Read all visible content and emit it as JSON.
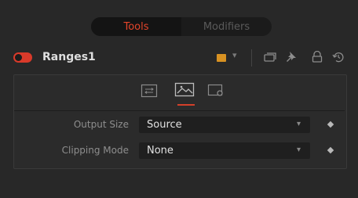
{
  "tabs": {
    "tools": "Tools",
    "modifiers": "Modifiers"
  },
  "node": {
    "name": "Ranges1",
    "color": "#d89222",
    "toggle_color": "#d93a2a"
  },
  "controls": [
    {
      "label": "Output Size",
      "value": "Source"
    },
    {
      "label": "Clipping Mode",
      "value": "None"
    }
  ],
  "icons": {
    "dropdown": "chevron-down-icon",
    "header": [
      "version-icon",
      "pin-icon",
      "lock-icon",
      "reset-icon"
    ],
    "subtabs": [
      "controls-icon",
      "image-icon",
      "settings-icon"
    ]
  }
}
